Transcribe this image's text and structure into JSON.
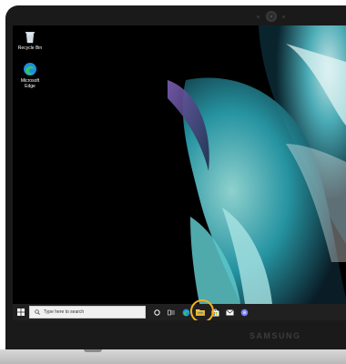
{
  "desktop": {
    "icons": [
      {
        "name": "recycle-bin",
        "label": "Recycle Bin"
      },
      {
        "name": "microsoft-edge",
        "label_line1": "Microsoft",
        "label_line2": "Edge"
      }
    ]
  },
  "taskbar": {
    "search_placeholder": "Type here to search",
    "apps": [
      "start-icon",
      "cortana-icon",
      "task-view-icon",
      "edge-icon",
      "file-explorer-icon",
      "store-icon",
      "mail-icon",
      "teams-icon"
    ],
    "highlighted_app": "file-explorer-icon"
  },
  "device": {
    "brand": "SAMSUNG"
  },
  "colors": {
    "highlight": "#f3b21b",
    "taskbar": "#202020",
    "wallpaper_accent": "#4fd3d3"
  }
}
